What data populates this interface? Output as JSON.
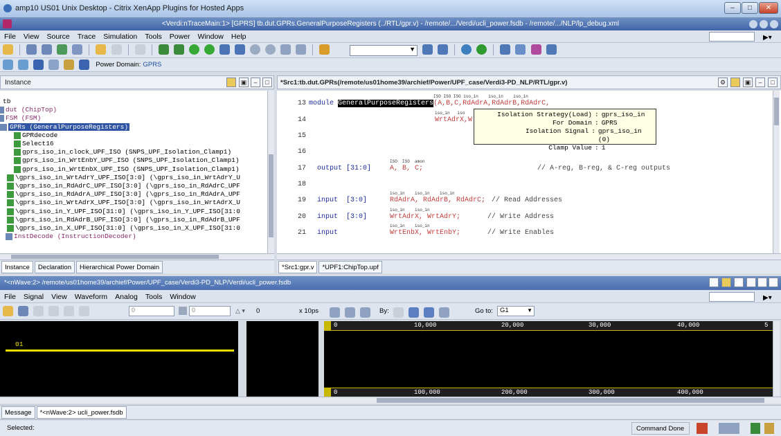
{
  "citrix": {
    "title": "amp10 US01 Unix Desktop - Citrix XenApp Plugins for Hosted Apps"
  },
  "app": {
    "title": "<Verdi:nTraceMain:1> [GPRS] tb.dut.GPRs.GeneralPurposeRegisters (../RTL/gpr.v) - /remote/.../Verdi/ucli_power.fsdb - /remote/.../NLP/lp_debug.xml"
  },
  "menu": [
    "File",
    "View",
    "Source",
    "Trace",
    "Simulation",
    "Tools",
    "Power",
    "Window",
    "Help"
  ],
  "power_domain": {
    "label": "Power Domain:",
    "value": "GPRS"
  },
  "instance": {
    "title": "Instance",
    "rows": [
      {
        "text": "tb",
        "color": "#000000"
      },
      {
        "text": "dut (ChipTop)",
        "color": "#8a2a6a"
      },
      {
        "text": "FSM (FSM)",
        "color": "#8a2a6a"
      },
      {
        "text": "GPRs (GeneralPurposeRegisters)",
        "color": "#ffffff",
        "selected": true
      },
      {
        "text": "GPRdecode",
        "color": "#000000"
      },
      {
        "text": "Select16",
        "color": "#000000"
      },
      {
        "text": "gprs_iso_in_clock_UPF_ISO (SNPS_UPF_Isolation_Clamp1)",
        "color": "#000000"
      },
      {
        "text": "gprs_iso_in_WrtEnbY_UPF_ISO (SNPS_UPF_Isolation_Clamp1)",
        "color": "#000000"
      },
      {
        "text": "gprs_iso_in_WrtEnbX_UPF_ISO (SNPS_UPF_Isolation_Clamp1)",
        "color": "#000000"
      },
      {
        "text": "\\gprs_iso_in_WrtAdrY_UPF_ISO[3:0] (\\gprs_iso_in_WrtAdrY_U",
        "color": "#000000"
      },
      {
        "text": "\\gprs_iso_in_RdAdrC_UPF_ISO[3:0] (\\gprs_iso_in_RdAdrC_UPF",
        "color": "#000000"
      },
      {
        "text": "\\gprs_iso_in_RdAdrA_UPF_ISO[3:0] (\\gprs_iso_in_RdAdrA_UPF",
        "color": "#000000"
      },
      {
        "text": "\\gprs_iso_in_WrtAdrX_UPF_ISO[3:0] (\\gprs_iso_in_WrtAdrX_U",
        "color": "#000000"
      },
      {
        "text": "\\gprs_iso_in_Y_UPF_ISO[31:0] (\\gprs_iso_in_Y_UPF_ISO[31:0",
        "color": "#000000"
      },
      {
        "text": "\\gprs_iso_in_RdAdrB_UPF_ISO[3:0] (\\gprs_iso_in_RdAdrB_UPF",
        "color": "#000000"
      },
      {
        "text": "\\gprs_iso_in_X_UPF_ISO[31:0] (\\gprs_iso_in_X_UPF_ISO[31:0",
        "color": "#000000"
      },
      {
        "text": "InstDecode (InstructionDecoder)",
        "color": "#8a2a6a"
      }
    ],
    "tabs": [
      "Instance",
      "Declaration",
      "Hierarchical Power Domain"
    ]
  },
  "source": {
    "title": "*Src1:tb.dut.GPRs(/remote/us01home39/archief/Power/UPF_case/Verdi3-PD_NLP/RTL/gpr.v)",
    "line_numbers": [
      "13",
      "14",
      "15",
      "16",
      "17",
      "18",
      "19",
      "20",
      "21"
    ],
    "line13": {
      "kw": "module",
      "name": "GeneralPurposeRegisters",
      "rest": "(A,B,C,RdAdrA,RdAdrB,RdAdrC,"
    },
    "line14": {
      "sigs": "WrtAdrX,W"
    },
    "line17": {
      "code": "output [31:0]",
      "sigs": "A, B, C;",
      "comment": "// A-reg, B-reg, & C-reg outputs"
    },
    "line19": {
      "code": "input  [3:0]",
      "sigs": "RdAdrA, RdAdrB, RdAdrC;",
      "comment": "// Read Addresses"
    },
    "line20": {
      "code": "input  [3:0]",
      "sigs": "WrtAdrX, WrtAdrY;",
      "comment": "// Write Address"
    },
    "line21": {
      "code": "input",
      "sigs": "WrtEnbX, WrtEnbY;",
      "comment": "// Write Enables"
    },
    "iso_labels": {
      "l13": "ISO ISO ISO iso_in    iso_in    iso_in",
      "l14": "iso_in   iso",
      "l17": "ISO  ISO  amon",
      "l19": "iso_in    iso_in    iso_in",
      "l20": "iso_in    iso_in",
      "l21": "iso_in    iso_in"
    },
    "tooltip": [
      {
        "k": "Isolation Strategy(Load)",
        "v": "gprs_iso_in"
      },
      {
        "k": "For Domain",
        "v": "GPRS"
      },
      {
        "k": "Isolation Signal",
        "v": "gprs_iso_in (0)"
      },
      {
        "k": "Clamp Value",
        "v": "1"
      }
    ],
    "tabs": [
      "*Src1:gpr.v",
      "*UPF1:ChipTop.upf"
    ]
  },
  "wave": {
    "title": "*<nWave:2> /remote/us01home39/archief/Power/UPF_case/Verdi3-PD_NLP/Verdi/ucli_power.fsdb",
    "menu": [
      "File",
      "Signal",
      "View",
      "Waveform",
      "Analog",
      "Tools",
      "Window"
    ],
    "time_scale": "x 10ps",
    "by_label": "By:",
    "goto_label": "Go to:",
    "goto_value": "G1",
    "field1": "0",
    "field2": "0",
    "field3": "0",
    "signal_value": "01",
    "top_ticks": [
      "0",
      "10,000",
      "20,000",
      "30,000",
      "40,000",
      "5"
    ],
    "bottom_ticks": [
      "0",
      "100,000",
      "200,000",
      "300,000",
      "400,000"
    ],
    "tabs": [
      "Message",
      "*<nWave:2> ucli_power.fsdb"
    ]
  },
  "status": {
    "left": "Selected:",
    "right": "Command Done"
  }
}
